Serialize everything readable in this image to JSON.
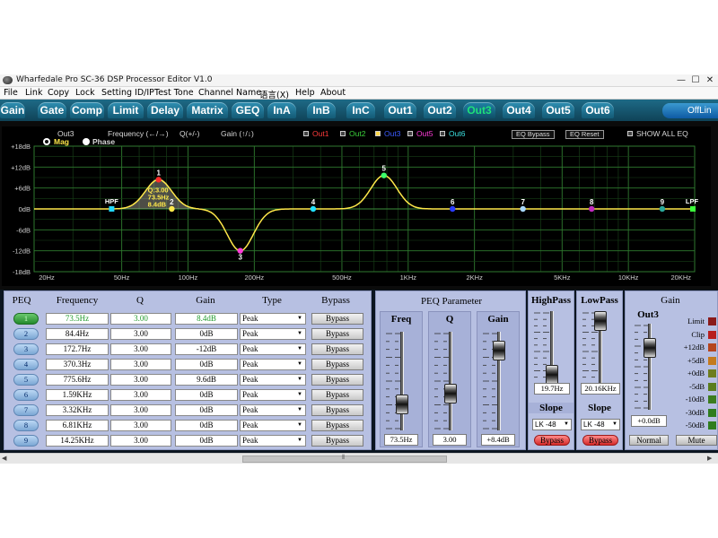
{
  "window": {
    "title": "Wharfedale Pro SC-36 DSP Processor Editor V1.0",
    "minimize": "—",
    "maximize": "☐",
    "close": "✕"
  },
  "menu": [
    "File",
    "Link",
    "Copy",
    "Lock",
    "Setting ID/IP",
    "Test Tone",
    "Channel Name",
    "语言(X)",
    "Help",
    "About"
  ],
  "tabs": [
    "Gain",
    "Gate",
    "Comp",
    "Limit",
    "Delay",
    "Matrix",
    "GEQ",
    "InA",
    "InB",
    "InC",
    "Out1",
    "Out2",
    "Out3",
    "Out4",
    "Out5",
    "Out6"
  ],
  "active_tab": "Out3",
  "offline_label": "OffLin",
  "graph": {
    "channel": "Out3",
    "frequency_hint": "Frequency (←/→)",
    "q_hint": "Q(+/-)",
    "gain_hint": "Gain (↑/↓)",
    "outputs": [
      {
        "label": "Out1",
        "color": "#ff3b3b"
      },
      {
        "label": "Out2",
        "color": "#3bd13b"
      },
      {
        "label": "Out3",
        "color": "#3b5bff"
      },
      {
        "label": "Out5",
        "color": "#ff3bd8"
      },
      {
        "label": "Out6",
        "color": "#3be0e0"
      }
    ],
    "eq_bypass": "EQ Bypass",
    "eq_reset": "EQ Reset",
    "show_all": "SHOW ALL EQ",
    "mag_label": "Mag",
    "phase_label": "Phase",
    "y_labels": [
      "+18dB",
      "+12dB",
      "+6dB",
      "0dB",
      "-6dB",
      "-12dB",
      "-18dB"
    ],
    "x_labels": [
      "20Hz",
      "50Hz",
      "100Hz",
      "200Hz",
      "500Hz",
      "1KHz",
      "2KHz",
      "5KHz",
      "10KHz",
      "20KHz"
    ],
    "hpf_label": "HPF",
    "lpf_label": "LPF",
    "tooltip_q": "Q:3.00",
    "tooltip_freq": "73.5Hz",
    "tooltip_gain": "8.4dB",
    "point_labels": [
      "1",
      "2",
      "3",
      "4",
      "5",
      "6",
      "7",
      "8",
      "9"
    ],
    "point_colors": [
      "#ff2a2a",
      "#ffe84a",
      "#ff3bd8",
      "#22e0ff",
      "#3bff6a",
      "#2a3bff",
      "#a8d8ff",
      "#c02ac0",
      "#2aa89a"
    ]
  },
  "peq": {
    "headers": [
      "PEQ",
      "Frequency",
      "Q",
      "Gain",
      "Type",
      "Bypass"
    ],
    "rows": [
      {
        "num": "1",
        "freq": "73.5Hz",
        "q": "3.00",
        "gain": "8.4dB",
        "type": "Peak",
        "bypass": "Bypass"
      },
      {
        "num": "2",
        "freq": "84.4Hz",
        "q": "3.00",
        "gain": "0dB",
        "type": "Peak",
        "bypass": "Bypass"
      },
      {
        "num": "3",
        "freq": "172.7Hz",
        "q": "3.00",
        "gain": "-12dB",
        "type": "Peak",
        "bypass": "Bypass"
      },
      {
        "num": "4",
        "freq": "370.3Hz",
        "q": "3.00",
        "gain": "0dB",
        "type": "Peak",
        "bypass": "Bypass"
      },
      {
        "num": "5",
        "freq": "775.6Hz",
        "q": "3.00",
        "gain": "9.6dB",
        "type": "Peak",
        "bypass": "Bypass"
      },
      {
        "num": "6",
        "freq": "1.59KHz",
        "q": "3.00",
        "gain": "0dB",
        "type": "Peak",
        "bypass": "Bypass"
      },
      {
        "num": "7",
        "freq": "3.32KHz",
        "q": "3.00",
        "gain": "0dB",
        "type": "Peak",
        "bypass": "Bypass"
      },
      {
        "num": "8",
        "freq": "6.81KHz",
        "q": "3.00",
        "gain": "0dB",
        "type": "Peak",
        "bypass": "Bypass"
      },
      {
        "num": "9",
        "freq": "14.25KHz",
        "q": "3.00",
        "gain": "0dB",
        "type": "Peak",
        "bypass": "Bypass"
      }
    ]
  },
  "peq_param": {
    "title": "PEQ Parameter",
    "freq_label": "Freq",
    "q_label": "Q",
    "gain_label": "Gain",
    "freq_value": "73.5Hz",
    "q_value": "3.00",
    "gain_value": "+8.4dB"
  },
  "highpass": {
    "title": "HighPass",
    "value": "19.7Hz",
    "slope_title": "Slope",
    "slope": "LK -48",
    "bypass": "Bypass"
  },
  "lowpass": {
    "title": "LowPass",
    "value": "20.16KHz",
    "slope_title": "Slope",
    "slope": "LK -48",
    "bypass": "Bypass"
  },
  "gain_panel": {
    "title": "Gain",
    "channel": "Out3",
    "value": "+0.0dB",
    "normal": "Normal",
    "mute": "Mute",
    "meter_labels": [
      "Limit",
      "Clip",
      "+12dB",
      "+5dB",
      "+0dB",
      "-5dB",
      "-10dB",
      "-30dB",
      "-50dB"
    ],
    "meter_colors": [
      "#8a1a1a",
      "#b81e1e",
      "#b5451e",
      "#c47a1e",
      "#6e7d1e",
      "#5a7d1e",
      "#3c7d1e",
      "#2e7d1e",
      "#2e7d1e"
    ]
  }
}
